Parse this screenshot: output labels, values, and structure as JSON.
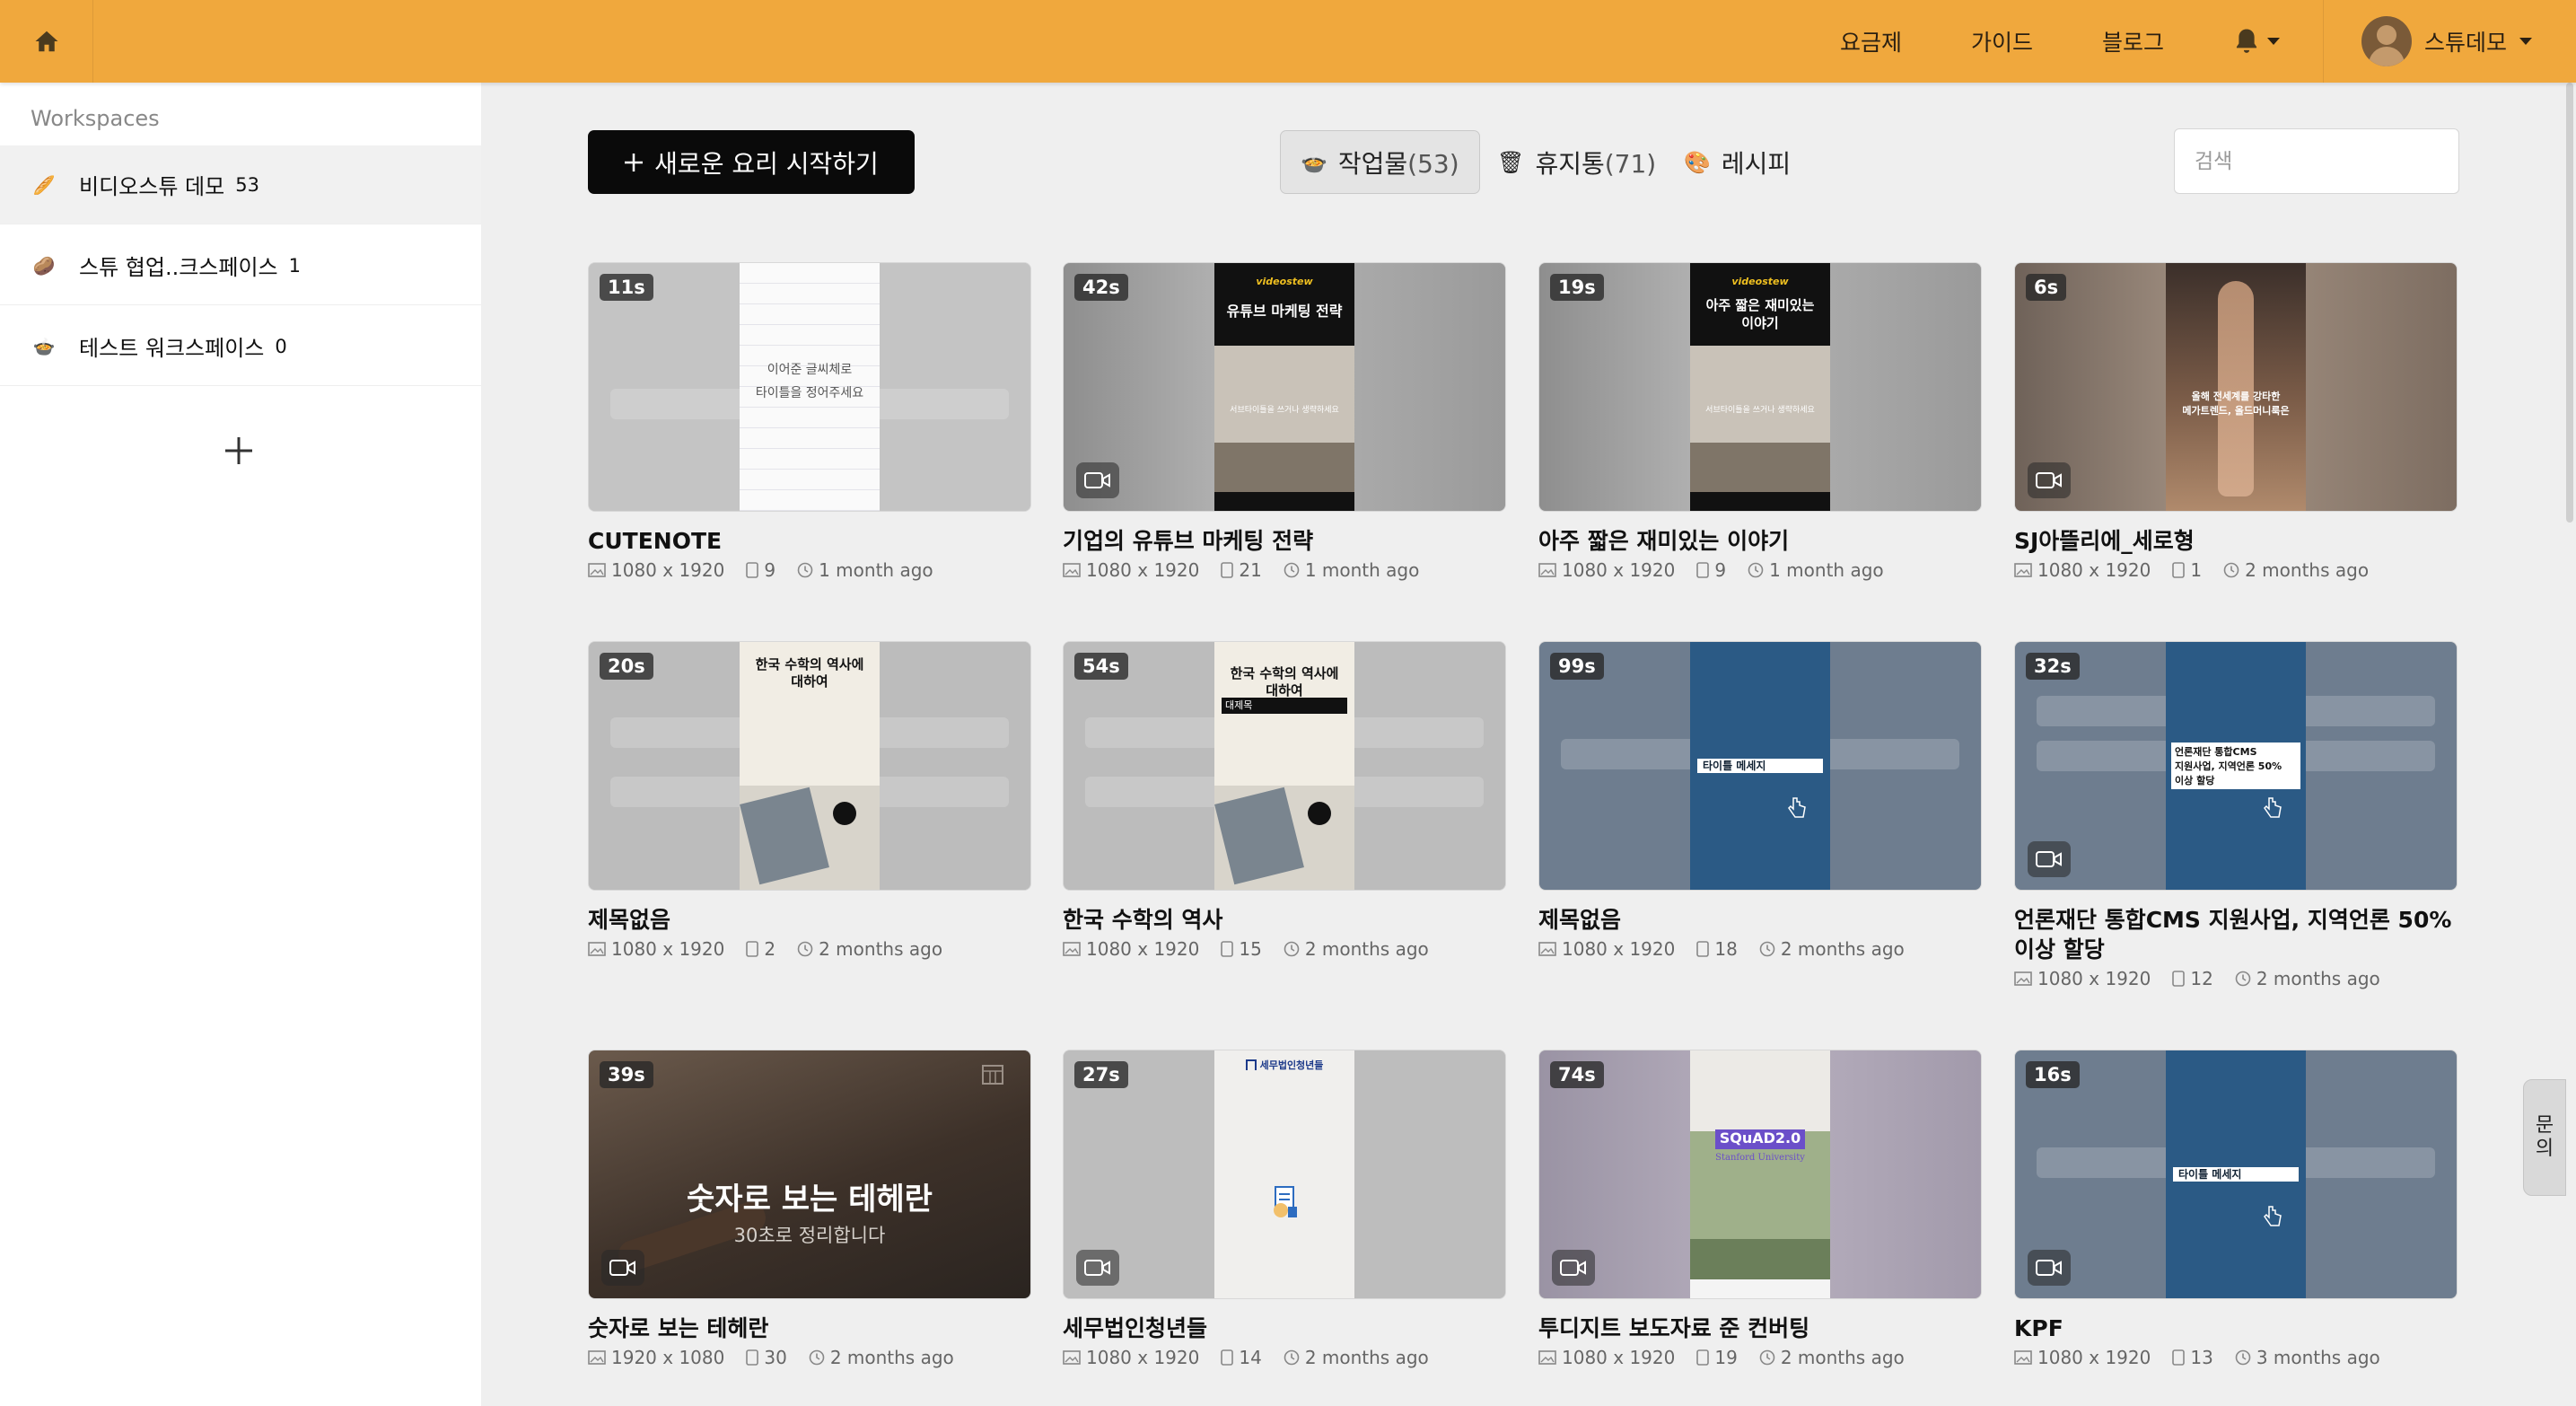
{
  "topbar": {
    "nav": [
      "요금제",
      "가이드",
      "블로그"
    ],
    "user_name": "스튜데모"
  },
  "sidebar": {
    "header": "Workspaces",
    "items": [
      {
        "emoji": "🥖",
        "name": "비디오스튜 데모",
        "count": "53"
      },
      {
        "emoji": "🥔",
        "name": "스튜 협업..크스페이스",
        "count": "1"
      },
      {
        "emoji": "🍲",
        "name": "테스트 워크스페이스",
        "count": "0"
      }
    ]
  },
  "toolbar": {
    "new_label": "새로운 요리 시작하기",
    "tabs": [
      {
        "emoji": "🍲",
        "label": "작업물",
        "count": "(53)"
      },
      {
        "emoji": "🗑",
        "label": "휴지통",
        "count": "(71)"
      },
      {
        "emoji": "🎨",
        "label": "레시피",
        "count": ""
      }
    ],
    "search_placeholder": "검색"
  },
  "cards": [
    {
      "duration": "11s",
      "title": "CUTENOTE",
      "size": "1080 x 1920",
      "pages": "9",
      "time": "1 month ago",
      "thumb_text": [
        "이어준 글씨체로",
        "타이틀을 정어주세요"
      ]
    },
    {
      "duration": "42s",
      "title": "기업의 유튜브 마케팅 전략",
      "size": "1080 x 1920",
      "pages": "21",
      "time": "1 month ago",
      "thumb_brand": "videostew",
      "thumb_text": [
        "유튜브 마케팅 전략"
      ],
      "thumb_sub": "서브타이틀을 쓰거나 생략하세요"
    },
    {
      "duration": "19s",
      "title": "아주 짧은 재미있는 이야기",
      "size": "1080 x 1920",
      "pages": "9",
      "time": "1 month ago",
      "thumb_brand": "videostew",
      "thumb_text": [
        "아주 짧은 재미있는",
        "이야기"
      ],
      "thumb_sub": "서브타이틀을 쓰거나 생략하세요"
    },
    {
      "duration": "6s",
      "title": "SJ아뜰리에_세로형",
      "size": "1080 x 1920",
      "pages": "1",
      "time": "2 months ago",
      "thumb_text": [
        "올해 전세계를 강타한",
        "메가트렌드, 올드머니룩은"
      ]
    },
    {
      "duration": "20s",
      "title": "제목없음",
      "size": "1080 x 1920",
      "pages": "2",
      "time": "2 months ago",
      "thumb_text": [
        "한국 수학의 역사에",
        "대하여"
      ]
    },
    {
      "duration": "54s",
      "title": "한국 수학의 역사",
      "size": "1080 x 1920",
      "pages": "15",
      "time": "2 months ago",
      "thumb_text": [
        "한국 수학의 역사에",
        "대하여"
      ],
      "thumb_label": "대제목"
    },
    {
      "duration": "99s",
      "title": "제목없음",
      "size": "1080 x 1920",
      "pages": "18",
      "time": "2 months ago",
      "thumb_bar": "타이틀 메세지"
    },
    {
      "duration": "32s",
      "title": "언론재단 통합CMS 지원사업, 지역언론 50% 이상 할당",
      "size": "1080 x 1920",
      "pages": "12",
      "time": "2 months ago",
      "thumb_text": [
        "언론재단 통합CMS",
        "지원사업, 지역언론 50%",
        "이상 할당"
      ]
    },
    {
      "duration": "39s",
      "title": "숫자로 보는 테헤란",
      "size": "1920 x 1080",
      "pages": "30",
      "time": "2 months ago",
      "thumb_text": [
        "숫자로 보는 테헤란"
      ],
      "thumb_sub": "30초로 정리합니다"
    },
    {
      "duration": "27s",
      "title": "세무법인청년들",
      "size": "1080 x 1920",
      "pages": "14",
      "time": "2 months ago",
      "thumb_brand": "세무법인청년들"
    },
    {
      "duration": "74s",
      "title": "투디지트 보도자료 준 컨버팅",
      "size": "1080 x 1920",
      "pages": "19",
      "time": "2 months ago",
      "thumb_text": [
        "SQuAD2.0"
      ],
      "thumb_sub": "Stanford University"
    },
    {
      "duration": "16s",
      "title": "KPF",
      "size": "1080 x 1920",
      "pages": "13",
      "time": "3 months ago",
      "thumb_bar": "타이틀 메세지"
    }
  ],
  "inquiry_label": [
    "문",
    "의"
  ],
  "colors": {
    "topbar": "#f0a83d",
    "primary_button": "#0a0a0a",
    "sidebar_bg": "#ffffff",
    "content_bg": "#efefef"
  }
}
